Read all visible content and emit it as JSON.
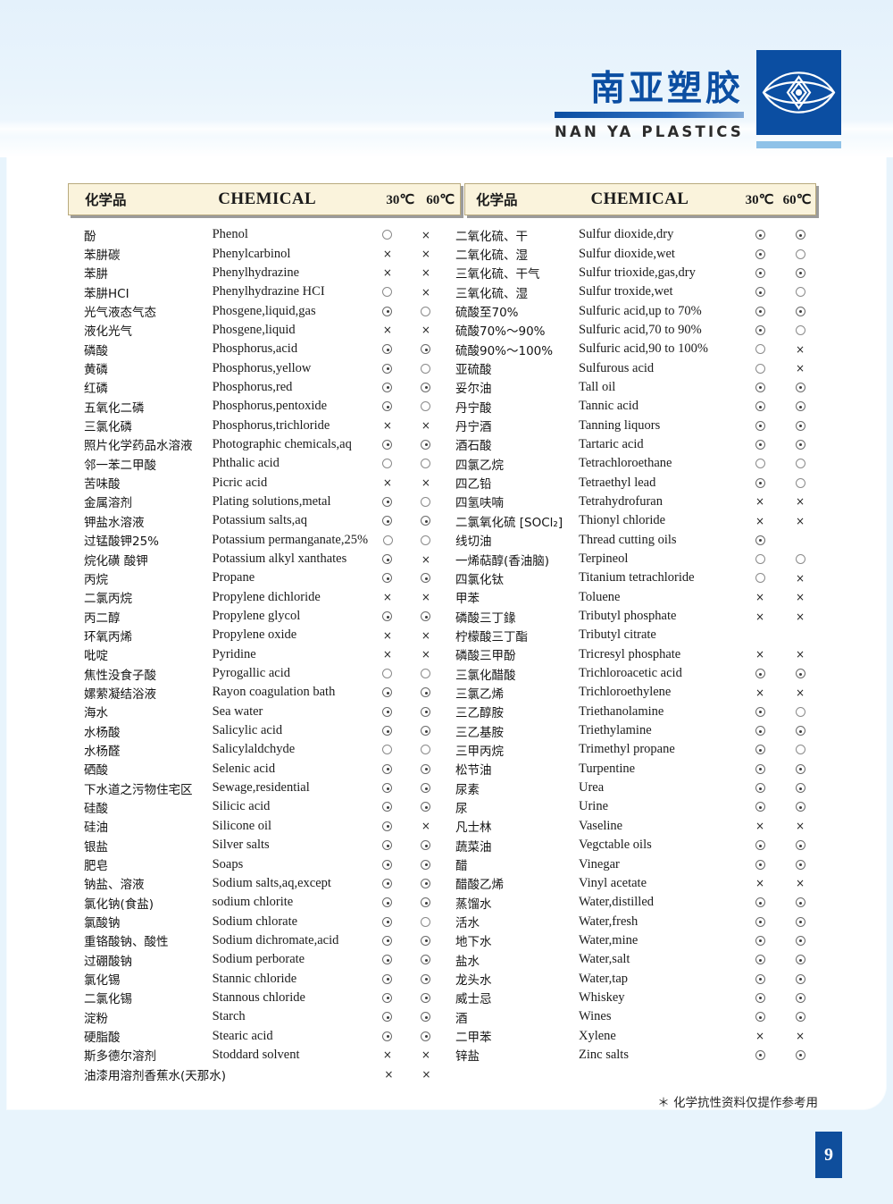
{
  "brand": {
    "name_cn": "南亚塑胶",
    "name_en": "NAN YA PLASTICS",
    "logo_icon": "nanya-diamond-logo-icon",
    "accent_color": "#0b4ea2",
    "underbar_color": "#8fc2e8"
  },
  "table": {
    "headers": {
      "chemical_cn": "化学品",
      "chemical_en": "CHEMICAL",
      "temp_30": "30℃",
      "temp_60": "60℃"
    },
    "symbol_legend": {
      "dot": "⊙",
      "circle": "○",
      "cross": "×",
      "none": ""
    },
    "left_rows": [
      {
        "cn": "酚",
        "en": "Phenol",
        "t30": "circle",
        "t60": "cross"
      },
      {
        "cn": "苯肼碳",
        "en": "Phenylcarbinol",
        "t30": "cross",
        "t60": "cross"
      },
      {
        "cn": "苯肼",
        "en": "Phenylhydrazine",
        "t30": "cross",
        "t60": "cross"
      },
      {
        "cn": "苯肼HCI",
        "en": "Phenylhydrazine HCI",
        "t30": "circle",
        "t60": "cross"
      },
      {
        "cn": "光气液态气态",
        "en": "Phosgene,liquid,gas",
        "t30": "dot",
        "t60": "circle"
      },
      {
        "cn": "液化光气",
        "en": "Phosgene,liquid",
        "t30": "cross",
        "t60": "cross"
      },
      {
        "cn": "磷酸",
        "en": "Phosphorus,acid",
        "t30": "dot",
        "t60": "dot"
      },
      {
        "cn": "黄磷",
        "en": "Phosphorus,yellow",
        "t30": "dot",
        "t60": "circle"
      },
      {
        "cn": "红磷",
        "en": "Phosphorus,red",
        "t30": "dot",
        "t60": "dot"
      },
      {
        "cn": "五氧化二磷",
        "en": "Phosphorus,pentoxide",
        "t30": "dot",
        "t60": "circle"
      },
      {
        "cn": "三氯化磷",
        "en": "Phosphorus,trichloride",
        "t30": "cross",
        "t60": "cross"
      },
      {
        "cn": "照片化学药品水溶液",
        "en": "Photographic chemicals,aq",
        "t30": "dot",
        "t60": "dot"
      },
      {
        "cn": "邻一苯二甲酸",
        "en": "Phthalic acid",
        "t30": "circle",
        "t60": "circle"
      },
      {
        "cn": "苦味酸",
        "en": "Picric acid",
        "t30": "cross",
        "t60": "cross"
      },
      {
        "cn": "金属溶剂",
        "en": "Plating solutions,metal",
        "t30": "dot",
        "t60": "circle"
      },
      {
        "cn": "钾盐水溶液",
        "en": "Potassium salts,aq",
        "t30": "dot",
        "t60": "dot"
      },
      {
        "cn": "过锰酸钾25%",
        "en": "Potassium permanganate,25%",
        "t30": "circle",
        "t60": "circle"
      },
      {
        "cn": "烷化磺 酸钾",
        "en": "Potassium alkyl xanthates",
        "t30": "dot",
        "t60": "cross"
      },
      {
        "cn": "丙烷",
        "en": "Propane",
        "t30": "dot",
        "t60": "dot"
      },
      {
        "cn": "二氯丙烷",
        "en": "Propylene dichloride",
        "t30": "cross",
        "t60": "cross"
      },
      {
        "cn": "丙二醇",
        "en": "Propylene glycol",
        "t30": "dot",
        "t60": "dot"
      },
      {
        "cn": "环氧丙烯",
        "en": "Propylene oxide",
        "t30": "cross",
        "t60": "cross"
      },
      {
        "cn": "吡啶",
        "en": "Pyridine",
        "t30": "cross",
        "t60": "cross"
      },
      {
        "cn": "焦性没食子酸",
        "en": "Pyrogallic acid",
        "t30": "circle",
        "t60": "circle"
      },
      {
        "cn": "嫘萦凝结浴液",
        "en": "Rayon coagulation bath",
        "t30": "dot",
        "t60": "dot"
      },
      {
        "cn": "海水",
        "en": "Sea water",
        "t30": "dot",
        "t60": "dot"
      },
      {
        "cn": "水杨酸",
        "en": "Salicylic acid",
        "t30": "dot",
        "t60": "dot"
      },
      {
        "cn": "水杨醛",
        "en": "Salicylaldchyde",
        "t30": "circle",
        "t60": "circle"
      },
      {
        "cn": "硒酸",
        "en": "Selenic acid",
        "t30": "dot",
        "t60": "dot"
      },
      {
        "cn": "下水道之污物住宅区",
        "en": "Sewage,residential",
        "t30": "dot",
        "t60": "dot"
      },
      {
        "cn": "硅酸",
        "en": "Silicic acid",
        "t30": "dot",
        "t60": "dot"
      },
      {
        "cn": "硅油",
        "en": "Silicone oil",
        "t30": "dot",
        "t60": "cross"
      },
      {
        "cn": "银盐",
        "en": "Silver salts",
        "t30": "dot",
        "t60": "dot"
      },
      {
        "cn": "肥皂",
        "en": "Soaps",
        "t30": "dot",
        "t60": "dot"
      },
      {
        "cn": "钠盐、溶液",
        "en": "Sodium salts,aq,except",
        "t30": "dot",
        "t60": "dot"
      },
      {
        "cn": "氯化钠(食盐)",
        "en": "sodium chlorite",
        "t30": "dot",
        "t60": "dot"
      },
      {
        "cn": "氯酸钠",
        "en": "Sodium chlorate",
        "t30": "dot",
        "t60": "circle"
      },
      {
        "cn": "重铬酸钠、酸性",
        "en": "Sodium dichromate,acid",
        "t30": "dot",
        "t60": "dot"
      },
      {
        "cn": "过硼酸钠",
        "en": "Sodium perborate",
        "t30": "dot",
        "t60": "dot"
      },
      {
        "cn": "氯化锡",
        "en": "Stannic chloride",
        "t30": "dot",
        "t60": "dot"
      },
      {
        "cn": "二氯化锡",
        "en": "Stannous chloride",
        "t30": "dot",
        "t60": "dot"
      },
      {
        "cn": "淀粉",
        "en": "Starch",
        "t30": "dot",
        "t60": "dot"
      },
      {
        "cn": "硬脂酸",
        "en": "Stearic acid",
        "t30": "dot",
        "t60": "dot"
      },
      {
        "cn": "斯多德尔溶剂",
        "en": "Stoddard solvent",
        "t30": "cross",
        "t60": "cross"
      },
      {
        "cn": "油漆用溶剂香蕉水(天那水)",
        "en": "",
        "t30": "cross",
        "t60": "cross"
      }
    ],
    "right_rows": [
      {
        "cn": "二氧化硫、干",
        "en": "Sulfur dioxide,dry",
        "t30": "dot",
        "t60": "dot"
      },
      {
        "cn": "二氧化硫、湿",
        "en": "Sulfur dioxide,wet",
        "t30": "dot",
        "t60": "circle"
      },
      {
        "cn": "三氧化硫、干气",
        "en": "Sulfur trioxide,gas,dry",
        "t30": "dot",
        "t60": "dot"
      },
      {
        "cn": "三氧化硫、湿",
        "en": "Sulfur troxide,wet",
        "t30": "dot",
        "t60": "circle"
      },
      {
        "cn": "硫酸至70%",
        "en": "Sulfuric acid,up to 70%",
        "t30": "dot",
        "t60": "dot"
      },
      {
        "cn": "硫酸70%～90%",
        "en": "Sulfuric acid,70 to 90%",
        "t30": "dot",
        "t60": "circle"
      },
      {
        "cn": "硫酸90%～100%",
        "en": "Sulfuric acid,90 to 100%",
        "t30": "circle",
        "t60": "cross"
      },
      {
        "cn": "亚硫酸",
        "en": "Sulfurous acid",
        "t30": "circle",
        "t60": "cross"
      },
      {
        "cn": "妥尔油",
        "en": "Tall oil",
        "t30": "dot",
        "t60": "dot"
      },
      {
        "cn": "丹宁酸",
        "en": "Tannic acid",
        "t30": "dot",
        "t60": "dot"
      },
      {
        "cn": "丹宁酒",
        "en": "Tanning liquors",
        "t30": "dot",
        "t60": "dot"
      },
      {
        "cn": "酒石酸",
        "en": "Tartaric acid",
        "t30": "dot",
        "t60": "dot"
      },
      {
        "cn": "四氯乙烷",
        "en": "Tetrachloroethane",
        "t30": "circle",
        "t60": "circle"
      },
      {
        "cn": "四乙铅",
        "en": "Tetraethyl lead",
        "t30": "dot",
        "t60": "circle"
      },
      {
        "cn": "四氢呋喃",
        "en": "Tetrahydrofuran",
        "t30": "cross",
        "t60": "cross"
      },
      {
        "cn": "二氯氧化硫 [SOCl₂]",
        "en": "Thionyl chloride",
        "t30": "cross",
        "t60": "cross"
      },
      {
        "cn": "线切油",
        "en": "Thread cutting oils",
        "t30": "dot",
        "t60": "none"
      },
      {
        "cn": "一烯萜醇(香油脑)",
        "en": "Terpineol",
        "t30": "circle",
        "t60": "circle"
      },
      {
        "cn": "四氯化钛",
        "en": "Titanium tetrachloride",
        "t30": "circle",
        "t60": "cross"
      },
      {
        "cn": "甲苯",
        "en": "Toluene",
        "t30": "cross",
        "t60": "cross"
      },
      {
        "cn": "磷酸三丁䤸",
        "en": "Tributyl phosphate",
        "t30": "cross",
        "t60": "cross"
      },
      {
        "cn": "柠檬酸三丁酯",
        "en": "Tributyl citrate",
        "t30": "none",
        "t60": "none"
      },
      {
        "cn": "磷酸三甲酚",
        "en": "Tricresyl phosphate",
        "t30": "cross",
        "t60": "cross"
      },
      {
        "cn": "三氯化醋酸",
        "en": "Trichloroacetic acid",
        "t30": "dot",
        "t60": "dot"
      },
      {
        "cn": "三氯乙烯",
        "en": "Trichloroethylene",
        "t30": "cross",
        "t60": "cross"
      },
      {
        "cn": "三乙醇胺",
        "en": "Triethanolamine",
        "t30": "dot",
        "t60": "circle"
      },
      {
        "cn": "三乙基胺",
        "en": "Triethylamine",
        "t30": "dot",
        "t60": "dot"
      },
      {
        "cn": "三甲丙烷",
        "en": "Trimethyl propane",
        "t30": "dot",
        "t60": "circle"
      },
      {
        "cn": "松节油",
        "en": "Turpentine",
        "t30": "dot",
        "t60": "dot"
      },
      {
        "cn": "尿素",
        "en": "Urea",
        "t30": "dot",
        "t60": "dot"
      },
      {
        "cn": "尿",
        "en": "Urine",
        "t30": "dot",
        "t60": "dot"
      },
      {
        "cn": "凡士林",
        "en": "Vaseline",
        "t30": "cross",
        "t60": "cross"
      },
      {
        "cn": "蔬菜油",
        "en": "Vegctable oils",
        "t30": "dot",
        "t60": "dot"
      },
      {
        "cn": "醋",
        "en": "Vinegar",
        "t30": "dot",
        "t60": "dot"
      },
      {
        "cn": "醋酸乙烯",
        "en": "Vinyl acetate",
        "t30": "cross",
        "t60": "cross"
      },
      {
        "cn": "蒸馏水",
        "en": "Water,distilled",
        "t30": "dot",
        "t60": "dot"
      },
      {
        "cn": "活水",
        "en": "Water,fresh",
        "t30": "dot",
        "t60": "dot"
      },
      {
        "cn": "地下水",
        "en": "Water,mine",
        "t30": "dot",
        "t60": "dot"
      },
      {
        "cn": "盐水",
        "en": "Water,salt",
        "t30": "dot",
        "t60": "dot"
      },
      {
        "cn": "龙头水",
        "en": "Water,tap",
        "t30": "dot",
        "t60": "dot"
      },
      {
        "cn": "威士忌",
        "en": "Whiskey",
        "t30": "dot",
        "t60": "dot"
      },
      {
        "cn": "酒",
        "en": "Wines",
        "t30": "dot",
        "t60": "dot"
      },
      {
        "cn": "二甲苯",
        "en": "Xylene",
        "t30": "cross",
        "t60": "cross"
      },
      {
        "cn": "锌盐",
        "en": "Zinc salts",
        "t30": "dot",
        "t60": "dot"
      }
    ]
  },
  "footnote": "＊ 化学抗性资料仅提作参考用",
  "page_number": "9"
}
